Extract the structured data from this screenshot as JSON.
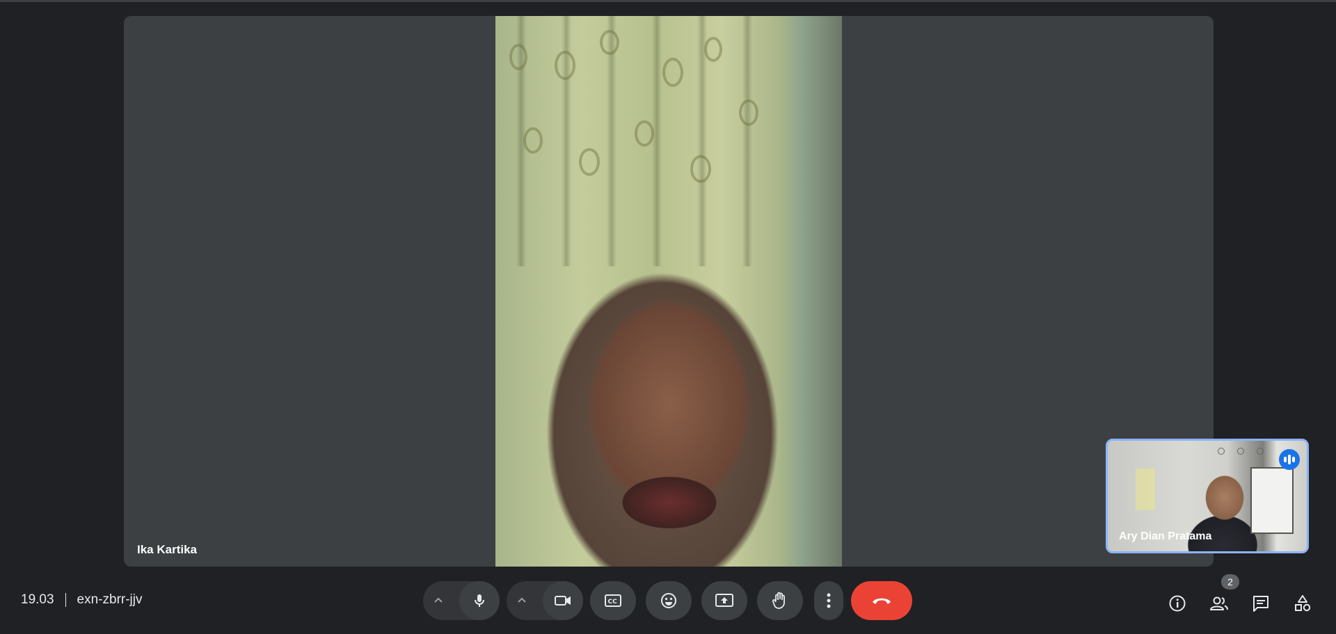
{
  "main_participant": {
    "name": "Ika Kartika"
  },
  "self_view": {
    "name": "Ary Dian Pratama",
    "speaking": true
  },
  "meeting": {
    "time": "19.03",
    "code": "exn-zbrr-jjv"
  },
  "controls": {
    "mic": "microphone-icon",
    "camera": "camera-icon",
    "captions": "captions-icon",
    "reactions": "emoji-icon",
    "present": "present-screen-icon",
    "raise_hand": "hand-icon",
    "more": "more-vert-icon",
    "leave": "end-call-icon"
  },
  "side_panel": {
    "people_count": "2"
  },
  "colors": {
    "background": "#202124",
    "stage": "#3c4043",
    "accent": "#8ab4f8",
    "end_call": "#ea4335",
    "speaking": "#1a73e8"
  }
}
